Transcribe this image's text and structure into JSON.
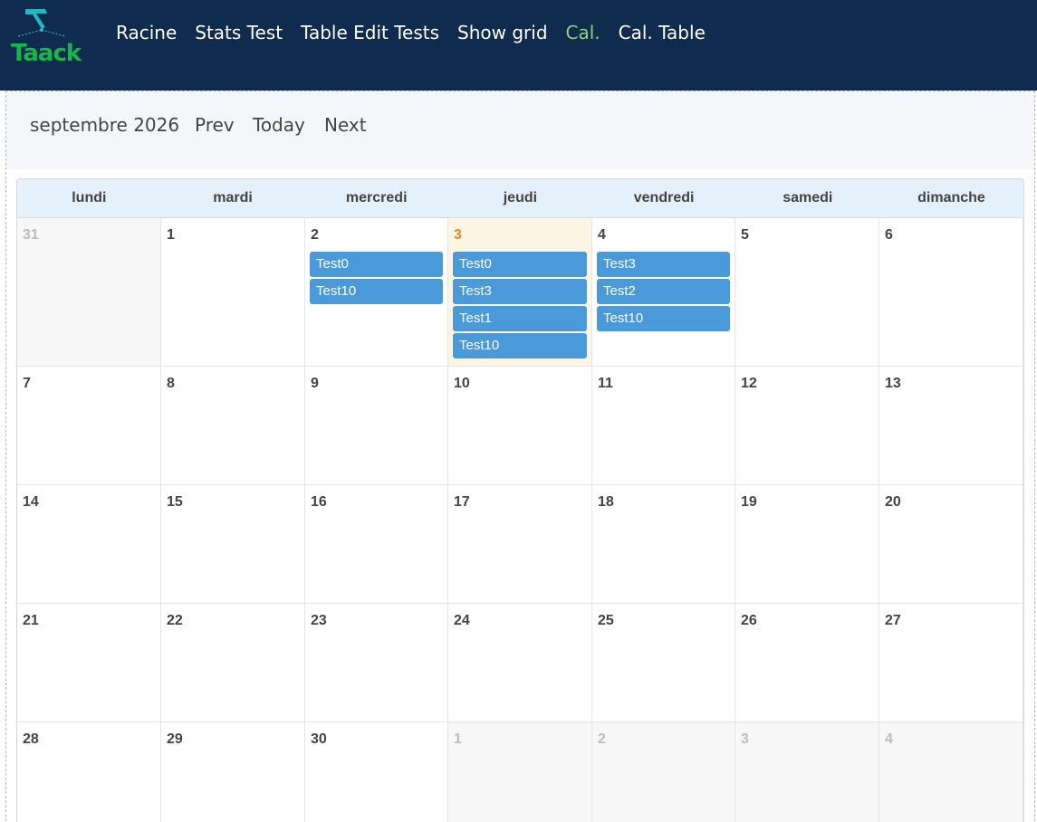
{
  "app": {
    "logo_text": "Taack"
  },
  "nav": {
    "items": [
      {
        "label": "Racine",
        "active": false
      },
      {
        "label": "Stats Test",
        "active": false
      },
      {
        "label": "Table Edit Tests",
        "active": false
      },
      {
        "label": "Show grid",
        "active": false
      },
      {
        "label": "Cal.",
        "active": true
      },
      {
        "label": "Cal. Table",
        "active": false
      }
    ]
  },
  "toolbar": {
    "month_label": "septembre 2026",
    "prev_label": "Prev",
    "today_label": "Today",
    "next_label": "Next"
  },
  "calendar": {
    "weekdays": [
      "lundi",
      "mardi",
      "mercredi",
      "jeudi",
      "vendredi",
      "samedi",
      "dimanche"
    ],
    "weeks": [
      [
        {
          "day": "31",
          "other": true,
          "events": []
        },
        {
          "day": "1",
          "events": []
        },
        {
          "day": "2",
          "events": [
            "Test0",
            "Test10"
          ]
        },
        {
          "day": "3",
          "today": true,
          "events": [
            "Test0",
            "Test3",
            "Test1",
            "Test10"
          ]
        },
        {
          "day": "4",
          "events": [
            "Test3",
            "Test2",
            "Test10"
          ]
        },
        {
          "day": "5",
          "events": []
        },
        {
          "day": "6",
          "events": []
        }
      ],
      [
        {
          "day": "7",
          "events": []
        },
        {
          "day": "8",
          "events": []
        },
        {
          "day": "9",
          "events": []
        },
        {
          "day": "10",
          "events": []
        },
        {
          "day": "11",
          "events": []
        },
        {
          "day": "12",
          "events": []
        },
        {
          "day": "13",
          "events": []
        }
      ],
      [
        {
          "day": "14",
          "events": []
        },
        {
          "day": "15",
          "events": []
        },
        {
          "day": "16",
          "events": []
        },
        {
          "day": "17",
          "events": []
        },
        {
          "day": "18",
          "events": []
        },
        {
          "day": "19",
          "events": []
        },
        {
          "day": "20",
          "events": []
        }
      ],
      [
        {
          "day": "21",
          "events": []
        },
        {
          "day": "22",
          "events": []
        },
        {
          "day": "23",
          "events": []
        },
        {
          "day": "24",
          "events": []
        },
        {
          "day": "25",
          "events": []
        },
        {
          "day": "26",
          "events": []
        },
        {
          "day": "27",
          "events": []
        }
      ],
      [
        {
          "day": "28",
          "events": []
        },
        {
          "day": "29",
          "events": []
        },
        {
          "day": "30",
          "events": []
        },
        {
          "day": "1",
          "other": true,
          "events": []
        },
        {
          "day": "2",
          "other": true,
          "events": []
        },
        {
          "day": "3",
          "other": true,
          "events": []
        },
        {
          "day": "4",
          "other": true,
          "events": []
        }
      ]
    ]
  },
  "colors": {
    "topbar": "#0f2b4e",
    "nav_active": "#8fd37a",
    "event": "#4a9ad9",
    "today_bg": "#fdf5e3",
    "today_number": "#e98a1f",
    "header_bg": "#e4f1fb",
    "logo_green": "#16b84a",
    "logo_teal": "#23b8c8"
  }
}
